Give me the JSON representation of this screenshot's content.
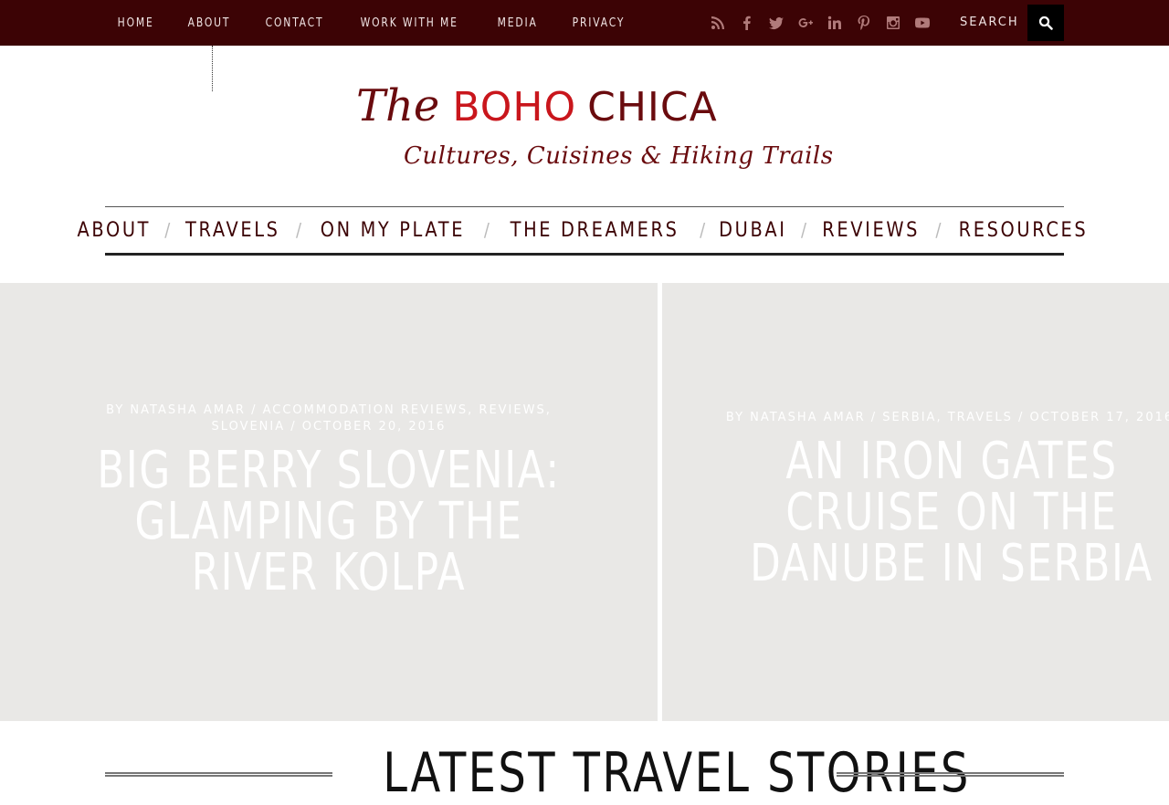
{
  "top_nav": {
    "items": [
      "HOME",
      "ABOUT",
      "CONTACT",
      "WORK WITH ME",
      "MEDIA",
      "PRIVACY"
    ]
  },
  "social_icons": [
    "rss-icon",
    "facebook-icon",
    "twitter-icon",
    "google-plus-icon",
    "linkedin-icon",
    "pinterest-icon",
    "instagram-icon",
    "youtube-icon"
  ],
  "search": {
    "label": "SEARCH"
  },
  "logo": {
    "the": "The",
    "boho": "BOHO",
    "chica": "CHICA",
    "tagline": "Cultures, Cuisines & Hiking Trails"
  },
  "main_nav": {
    "items": [
      "ABOUT",
      "TRAVELS",
      "ON MY PLATE",
      "THE DREAMERS",
      "DUBAI",
      "REVIEWS",
      "RESOURCES"
    ]
  },
  "featured": [
    {
      "meta_line1": "BY NATASHA AMAR  /  ACCOMMODATION REVIEWS, REVIEWS,",
      "meta_line2": "SLOVENIA / OCTOBER 20, 2016",
      "title_line1": "BIG BERRY SLOVENIA:",
      "title_line2": "GLAMPING BY THE",
      "title_line3": "RIVER KOLPA"
    },
    {
      "meta_line1": "BY NATASHA AMAR  /  SERBIA, TRAVELS / OCTOBER 17, 2016",
      "title_line1": "AN IRON GATES",
      "title_line2": "CRUISE ON THE",
      "title_line3": "DANUBE IN SERBIA"
    }
  ],
  "section": {
    "title": "LATEST TRAVEL STORIES"
  },
  "colors": {
    "topbar": "#3c0305",
    "logo_red": "#c9161c",
    "logo_dark": "#6a0b0e",
    "panel_bg": "#e9e8e6"
  }
}
